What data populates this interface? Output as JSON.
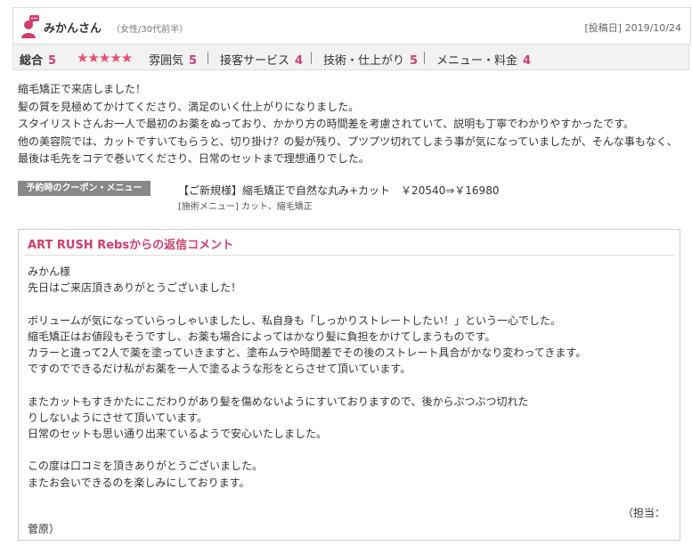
{
  "reviewer": {
    "name": "みかんさん",
    "info": "（女性/30代前半）",
    "posted": "[投稿日] 2019/10/24"
  },
  "ratings": {
    "overall_label": "総合",
    "overall_value": "5",
    "stars": "★★★★★",
    "items": [
      {
        "label": "雰囲気",
        "value": "5"
      },
      {
        "label": "接客サービス",
        "value": "4"
      },
      {
        "label": "技術・仕上がり",
        "value": "5"
      },
      {
        "label": "メニュー・料金",
        "value": "4"
      }
    ]
  },
  "review": {
    "lines": [
      "縮毛矯正で来店しました！",
      "髪の質を見極めてかけてくださり、満足のいく仕上がりになりました。",
      "スタイリストさんお一人で最初のお薬をぬっており、かかり方の時間差を考慮されていて、説明も丁寧でわかりやすかったです。",
      "他の美容院では、カットですいてもらうと、切り掛け？の髪が残り、プツプツ切れてしまう事が気になっていましたが、そんな事もなく、",
      "最後は毛先をコテで巻いてくださり、日常のセットまで理想通りでした。"
    ]
  },
  "coupon": {
    "tag": "予約時のクーポン・メニュー",
    "name": "【ご新規様】縮毛矯正で自然な丸み+カット　￥20540⇒￥16980",
    "menu": "[施術メニュー] カット、縮毛矯正"
  },
  "reply": {
    "title": "ART RUSH Rebsからの返信コメント",
    "lines": [
      "みかん様",
      "先日はご来店頂きありがとうございました！",
      "",
      "ボリュームが気になっていらっしゃいましたし、私自身も「しっかりストレートしたい！」という一心でした。",
      "縮毛矯正はお値段もそうですし、お薬も場合によってはかなり髪に負担をかけてしまうものです。",
      "カラーと違って2人で薬を塗っていきますと、塗布ムラや時間差でその後のストレート具合がかなり変わってきます。",
      "ですのでできるだけ私がお薬を一人で塗るような形をとらさせて頂いています。",
      "",
      "またカットもすきかたにこだわりがあり髪を傷めないようにすいておりますので、後からぶつぶつ切れた",
      "りしないようにさせて頂いています。",
      "日常のセットも思い通り出来ているようで安心いたしました。",
      "",
      "この度は口コミを頂きありがとうございました。",
      "またお会いできるのを楽しみにしております。"
    ],
    "sig_part1": "（担当：",
    "sig_part2": "菅原）"
  }
}
